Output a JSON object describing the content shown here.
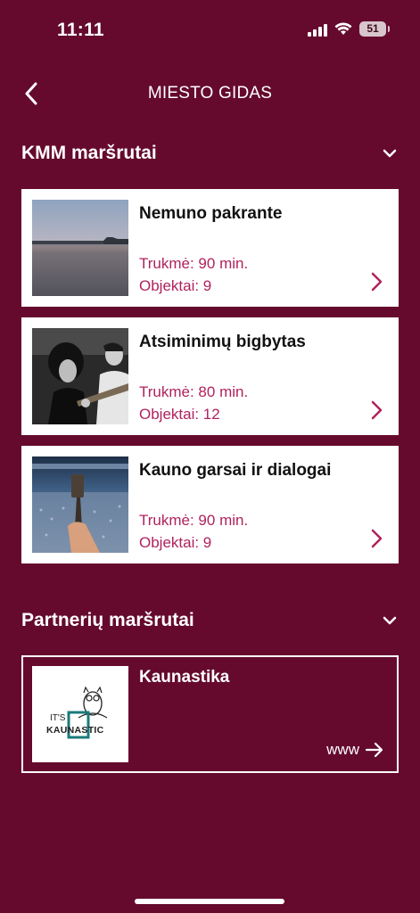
{
  "status_bar": {
    "time": "11:11",
    "battery": "51"
  },
  "header": {
    "title": "MIESTO GIDAS",
    "back_icon": "chevron-left-icon"
  },
  "sections": [
    {
      "title": "KMM maršrutai",
      "icon": "chevron-down-icon",
      "routes": [
        {
          "title": "Nemuno pakrante",
          "duration": "Trukmė: 90 min.",
          "objects": "Objektai: 9",
          "image": "river-sunset-photo"
        },
        {
          "title": "Atsiminimų bigbytas",
          "duration": "Trukmė: 80 min.",
          "objects": "Objektai: 12",
          "image": "band-bw-photo"
        },
        {
          "title": "Kauno garsai ir dialogai",
          "duration": "Trukmė: 90 min.",
          "objects": "Objektai: 9",
          "image": "arena-crowd-photo"
        }
      ]
    },
    {
      "title": "Partnerių maršrutai",
      "icon": "chevron-down-icon",
      "partners": [
        {
          "title": "Kaunastika",
          "link_label": "www",
          "logo_text_top": "IT'S",
          "logo_text_main": "KAUNASTIC"
        }
      ]
    }
  ],
  "colors": {
    "background": "#650a2d",
    "accent": "#b0225d",
    "card": "#ffffff"
  }
}
